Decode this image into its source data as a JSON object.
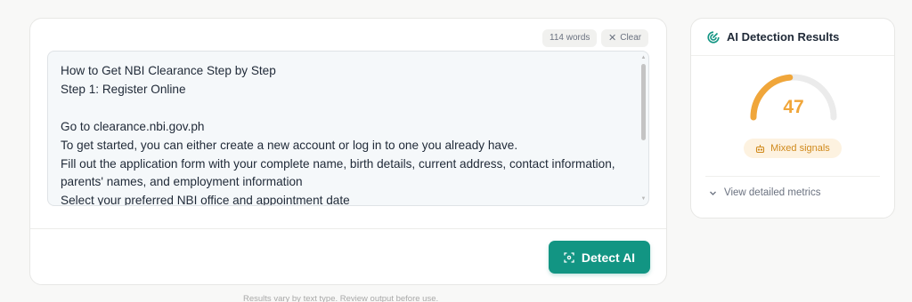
{
  "editor": {
    "word_count": "114 words",
    "clear_label": "Clear",
    "text": "How to Get NBI Clearance Step by Step\nStep 1: Register Online\n\nGo to clearance.nbi.gov.ph\nTo get started, you can either create a new account or log in to one you already have.\nFill out the application form with your complete name, birth details, current address, contact information, parents' names, and employment information\nSelect your preferred NBI office and appointment date",
    "detect_label": "Detect AI",
    "footnote": "Results vary by text type. Review output before use."
  },
  "results": {
    "title": "AI Detection Results",
    "score": 47,
    "score_label": "47",
    "badge": "Mixed signals",
    "metrics_link": "View detailed metrics"
  },
  "colors": {
    "accent": "#129583",
    "gauge_fill": "#f0a63a",
    "gauge_track": "#ebebeb",
    "badge_bg": "#fdf2e0",
    "badge_text": "#d08a1c"
  },
  "icons": {
    "clear": "close-icon",
    "detect": "scan-icon",
    "results_header": "radar-icon",
    "badge": "robot-icon",
    "metrics": "chevron-down-icon"
  }
}
